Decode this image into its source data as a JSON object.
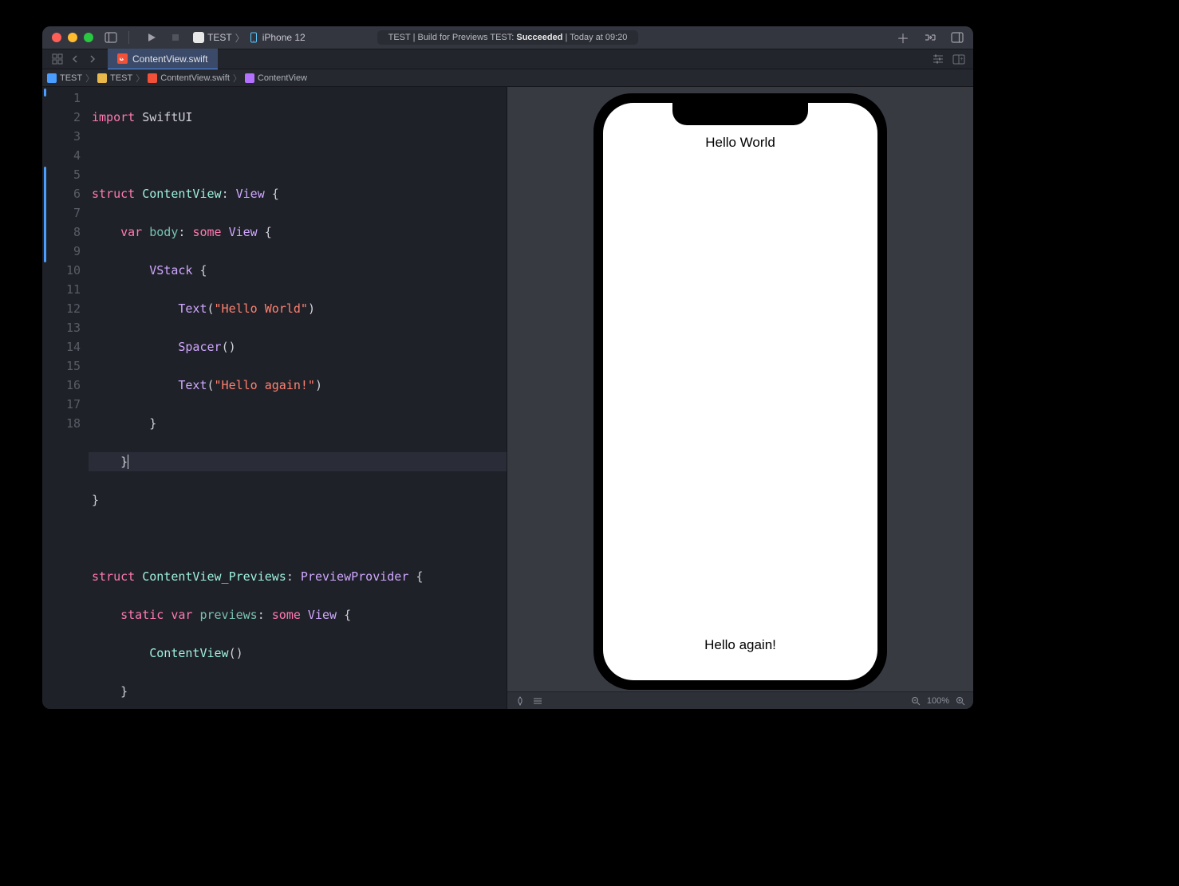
{
  "titlebar": {
    "scheme_target": "TEST",
    "scheme_device": "iPhone 12",
    "status_prefix": "TEST | Build for Previews TEST: ",
    "status_strong": "Succeeded",
    "status_suffix": " | Today at 09:20"
  },
  "tab": {
    "filename": "ContentView.swift"
  },
  "breadcrumb": {
    "c0": "TEST",
    "c1": "TEST",
    "c2": "ContentView.swift",
    "c3": "ContentView"
  },
  "code": {
    "l1_kw": "import",
    "l1_rest": " SwiftUI",
    "l3_kw": "struct",
    "l3_type": " ContentView",
    "l3_rest": ": ",
    "l3_proto": "View",
    "l3_brace": " {",
    "l4_kw": "var",
    "l4_id": " body",
    "l4_colon": ": ",
    "l4_some": "some",
    "l4_view": " View",
    "l4_brace": " {",
    "l5_vstack": "VStack",
    "l5_brace": " {",
    "l6_text": "Text",
    "l6_open": "(",
    "l6_str": "\"Hello World\"",
    "l6_close": ")",
    "l7_spacer": "Spacer",
    "l7_parens": "()",
    "l8_text": "Text",
    "l8_open": "(",
    "l8_str": "\"Hello again!\"",
    "l8_close": ")",
    "l9": "}",
    "l10": "}",
    "l11": "}",
    "l13_kw": "struct",
    "l13_type": " ContentView_Previews",
    "l13_rest": ": ",
    "l13_proto": "PreviewProvider",
    "l13_brace": " {",
    "l14_static": "static",
    "l14_var": " var",
    "l14_id": " previews",
    "l14_colon": ": ",
    "l14_some": "some",
    "l14_view": " View",
    "l14_brace": " {",
    "l15_call": "ContentView",
    "l15_parens": "()",
    "l16": "}",
    "l17": "}"
  },
  "line_numbers": [
    "1",
    "2",
    "3",
    "4",
    "5",
    "6",
    "7",
    "8",
    "9",
    "10",
    "11",
    "12",
    "13",
    "14",
    "15",
    "16",
    "17",
    "18"
  ],
  "preview": {
    "top_text": "Hello World",
    "bottom_text": "Hello again!"
  },
  "canvas_footer": {
    "zoom": "100%"
  }
}
